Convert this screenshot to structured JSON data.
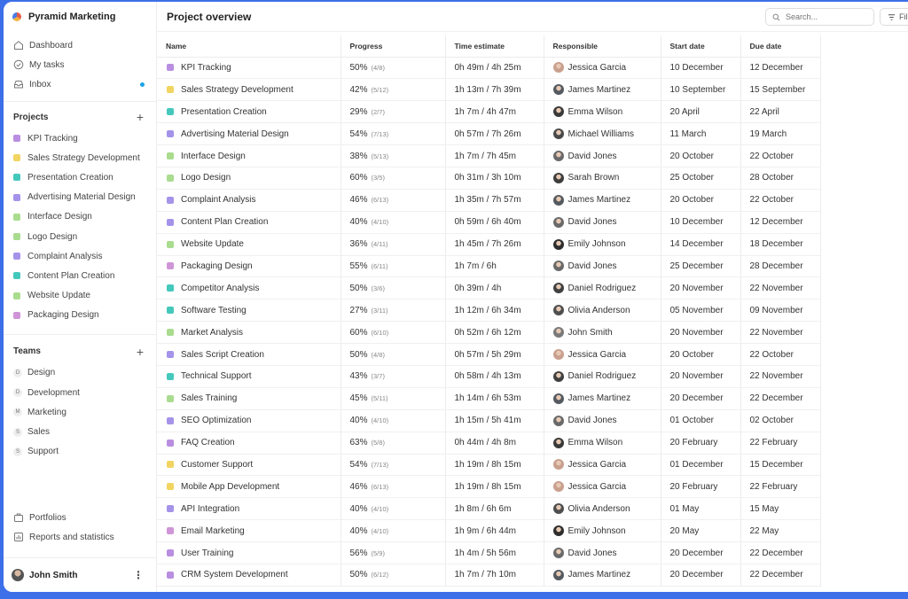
{
  "app": {
    "name": "Pyramid Marketing"
  },
  "nav": [
    {
      "label": "Dashboard",
      "icon": "home-icon"
    },
    {
      "label": "My tasks",
      "icon": "check-circle-icon"
    },
    {
      "label": "Inbox",
      "icon": "inbox-icon",
      "badge": true
    }
  ],
  "projects": {
    "title": "Projects",
    "items": [
      {
        "label": "KPI Tracking",
        "color": "#b98ee0"
      },
      {
        "label": "Sales Strategy Development",
        "color": "#f2d561"
      },
      {
        "label": "Presentation Creation",
        "color": "#45c8bc"
      },
      {
        "label": "Advertising Material Design",
        "color": "#a593ea"
      },
      {
        "label": "Interface Design",
        "color": "#a9dc8f"
      },
      {
        "label": "Logo Design",
        "color": "#a9dc8f"
      },
      {
        "label": "Complaint Analysis",
        "color": "#a593ea"
      },
      {
        "label": "Content Plan Creation",
        "color": "#45c8bc"
      },
      {
        "label": "Website Update",
        "color": "#a9dc8f"
      },
      {
        "label": "Packaging Design",
        "color": "#d095d8"
      }
    ]
  },
  "teams": {
    "title": "Teams",
    "items": [
      {
        "initial": "D",
        "label": "Design"
      },
      {
        "initial": "D",
        "label": "Development"
      },
      {
        "initial": "M",
        "label": "Marketing"
      },
      {
        "initial": "S",
        "label": "Sales"
      },
      {
        "initial": "S",
        "label": "Support"
      }
    ]
  },
  "bottom_links": [
    {
      "label": "Portfolios",
      "icon": "briefcase-icon"
    },
    {
      "label": "Reports and statistics",
      "icon": "chart-icon"
    }
  ],
  "user": {
    "name": "John Smith"
  },
  "header": {
    "title": "Project overview",
    "search_placeholder": "Search...",
    "filter_label": "Fil"
  },
  "columns": [
    "Name",
    "Progress",
    "Time estimate",
    "Responsible",
    "Start date",
    "Due date"
  ],
  "rows": [
    {
      "name": "KPI Tracking",
      "color": "#b98ee0",
      "pct": "50%",
      "frac": "(4/8)",
      "time": "0h 49m / 4h 25m",
      "resp": "Jessica Garcia",
      "av": "#c9a08e",
      "start": "10 December",
      "due": "12 December"
    },
    {
      "name": "Sales Strategy Development",
      "color": "#f2d561",
      "pct": "42%",
      "frac": "(5/12)",
      "time": "1h 13m / 7h 39m",
      "resp": "James Martinez",
      "av": "#555a60",
      "start": "10 September",
      "due": "15 September"
    },
    {
      "name": "Presentation Creation",
      "color": "#45c8bc",
      "pct": "29%",
      "frac": "(2/7)",
      "time": "1h 7m / 4h 47m",
      "resp": "Emma Wilson",
      "av": "#3a3a3a",
      "start": "20 April",
      "due": "22 April"
    },
    {
      "name": "Advertising Material Design",
      "color": "#a593ea",
      "pct": "54%",
      "frac": "(7/13)",
      "time": "0h 57m / 7h 26m",
      "resp": "Michael Williams",
      "av": "#4a4a4a",
      "start": "11 March",
      "due": "19 March"
    },
    {
      "name": "Interface Design",
      "color": "#a9dc8f",
      "pct": "38%",
      "frac": "(5/13)",
      "time": "1h 7m / 7h 45m",
      "resp": "David Jones",
      "av": "#6a6a6a",
      "start": "20 October",
      "due": "22 October"
    },
    {
      "name": "Logo Design",
      "color": "#a9dc8f",
      "pct": "60%",
      "frac": "(3/5)",
      "time": "0h 31m / 3h 10m",
      "resp": "Sarah Brown",
      "av": "#3d3d3d",
      "start": "25 October",
      "due": "28 October"
    },
    {
      "name": "Complaint Analysis",
      "color": "#a593ea",
      "pct": "46%",
      "frac": "(6/13)",
      "time": "1h 35m / 7h 57m",
      "resp": "James Martinez",
      "av": "#555a60",
      "start": "20 October",
      "due": "22 October"
    },
    {
      "name": "Content Plan Creation",
      "color": "#a593ea",
      "pct": "40%",
      "frac": "(4/10)",
      "time": "0h 59m / 6h 40m",
      "resp": "David Jones",
      "av": "#6a6a6a",
      "start": "10 December",
      "due": "12 December"
    },
    {
      "name": "Website Update",
      "color": "#a9dc8f",
      "pct": "36%",
      "frac": "(4/11)",
      "time": "1h 45m / 7h 26m",
      "resp": "Emily Johnson",
      "av": "#2e2e2e",
      "start": "14 December",
      "due": "18 December"
    },
    {
      "name": "Packaging Design",
      "color": "#d095d8",
      "pct": "55%",
      "frac": "(6/11)",
      "time": "1h 7m / 6h",
      "resp": "David Jones",
      "av": "#6a6a6a",
      "start": "25 December",
      "due": "28 December"
    },
    {
      "name": "Competitor Analysis",
      "color": "#45c8bc",
      "pct": "50%",
      "frac": "(3/6)",
      "time": "0h 39m / 4h",
      "resp": "Daniel Rodriguez",
      "av": "#404040",
      "start": "20 November",
      "due": "22 November"
    },
    {
      "name": "Software Testing",
      "color": "#45c8bc",
      "pct": "27%",
      "frac": "(3/11)",
      "time": "1h 12m / 6h 34m",
      "resp": "Olivia Anderson",
      "av": "#4f4f4f",
      "start": "05 November",
      "due": "09 November"
    },
    {
      "name": "Market Analysis",
      "color": "#a9dc8f",
      "pct": "60%",
      "frac": "(6/10)",
      "time": "0h 52m / 6h 12m",
      "resp": "John Smith",
      "av": "#7a7a7a",
      "start": "20 November",
      "due": "22 November"
    },
    {
      "name": "Sales Script Creation",
      "color": "#a593ea",
      "pct": "50%",
      "frac": "(4/8)",
      "time": "0h 57m / 5h 29m",
      "resp": "Jessica Garcia",
      "av": "#c9a08e",
      "start": "20 October",
      "due": "22 October"
    },
    {
      "name": "Technical Support",
      "color": "#45c8bc",
      "pct": "43%",
      "frac": "(3/7)",
      "time": "0h 58m / 4h 13m",
      "resp": "Daniel Rodriguez",
      "av": "#404040",
      "start": "20 November",
      "due": "22 November"
    },
    {
      "name": "Sales Training",
      "color": "#a9dc8f",
      "pct": "45%",
      "frac": "(5/11)",
      "time": "1h 14m / 6h 53m",
      "resp": "James Martinez",
      "av": "#555a60",
      "start": "20 December",
      "due": "22 December"
    },
    {
      "name": "SEO Optimization",
      "color": "#a593ea",
      "pct": "40%",
      "frac": "(4/10)",
      "time": "1h 15m / 5h 41m",
      "resp": "David Jones",
      "av": "#6a6a6a",
      "start": "01 October",
      "due": "02 October"
    },
    {
      "name": "FAQ Creation",
      "color": "#b98ee0",
      "pct": "63%",
      "frac": "(5/8)",
      "time": "0h 44m / 4h 8m",
      "resp": "Emma Wilson",
      "av": "#3a3a3a",
      "start": "20 February",
      "due": "22 February"
    },
    {
      "name": "Customer Support",
      "color": "#f2d561",
      "pct": "54%",
      "frac": "(7/13)",
      "time": "1h 19m / 8h 15m",
      "resp": "Jessica Garcia",
      "av": "#c9a08e",
      "start": "01 December",
      "due": "15 December"
    },
    {
      "name": "Mobile App Development",
      "color": "#f2d561",
      "pct": "46%",
      "frac": "(6/13)",
      "time": "1h 19m / 8h 15m",
      "resp": "Jessica Garcia",
      "av": "#c9a08e",
      "start": "20 February",
      "due": "22 February"
    },
    {
      "name": "API Integration",
      "color": "#a593ea",
      "pct": "40%",
      "frac": "(4/10)",
      "time": "1h 8m / 6h 6m",
      "resp": "Olivia Anderson",
      "av": "#4f4f4f",
      "start": "01 May",
      "due": "15 May"
    },
    {
      "name": "Email Marketing",
      "color": "#d095d8",
      "pct": "40%",
      "frac": "(4/10)",
      "time": "1h 9m / 6h 44m",
      "resp": "Emily Johnson",
      "av": "#2e2e2e",
      "start": "20 May",
      "due": "22 May"
    },
    {
      "name": "User Training",
      "color": "#b98ee0",
      "pct": "56%",
      "frac": "(5/9)",
      "time": "1h 4m / 5h 56m",
      "resp": "David Jones",
      "av": "#6a6a6a",
      "start": "20 December",
      "due": "22 December"
    },
    {
      "name": "CRM System Development",
      "color": "#b98ee0",
      "pct": "50%",
      "frac": "(6/12)",
      "time": "1h 7m / 7h 10m",
      "resp": "James Martinez",
      "av": "#555a60",
      "start": "20 December",
      "due": "22 December"
    }
  ]
}
